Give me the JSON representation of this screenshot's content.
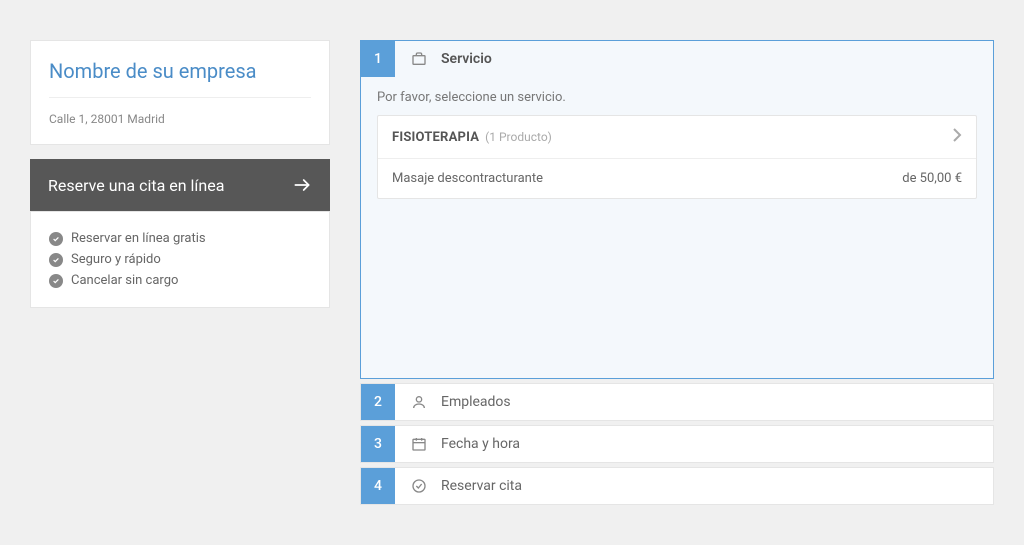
{
  "company": {
    "name": "Nombre de su empresa",
    "address": "Calle 1, 28001 Madrid"
  },
  "cta": {
    "label": "Reserve una cita en línea"
  },
  "benefits": [
    "Reservar en línea gratis",
    "Seguro y rápido",
    "Cancelar sin cargo"
  ],
  "wizard": {
    "steps": [
      {
        "num": "1",
        "label": "Servicio"
      },
      {
        "num": "2",
        "label": "Empleados"
      },
      {
        "num": "3",
        "label": "Fecha y hora"
      },
      {
        "num": "4",
        "label": "Reservar cita"
      }
    ],
    "prompt": "Por favor, seleccione un servicio.",
    "category": {
      "name": "FISIOTERAPIA",
      "count": "(1 Producto)"
    },
    "items": [
      {
        "name": "Masaje descontracturante",
        "price": "de 50,00 €"
      }
    ]
  }
}
